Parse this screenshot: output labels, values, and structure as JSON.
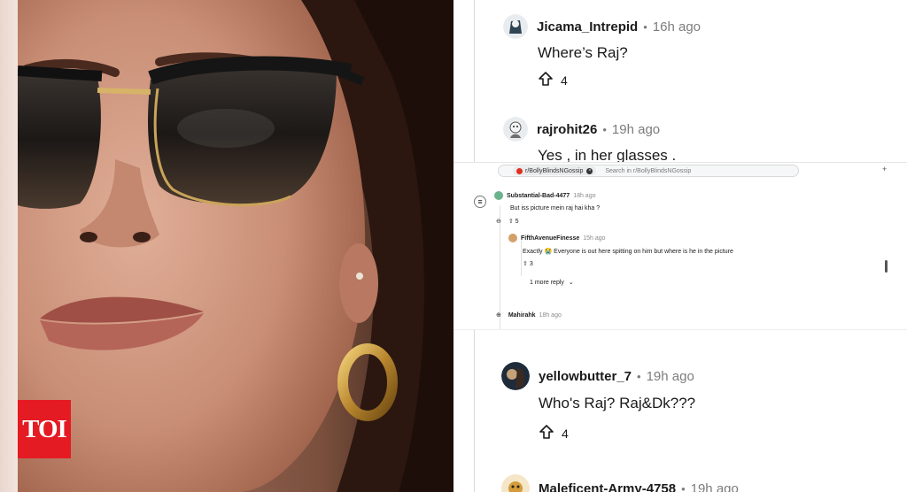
{
  "watermark": {
    "logo_text": "TOI"
  },
  "thread": {
    "comments": [
      {
        "username": "Jicama_Intrepid",
        "time": "16h ago",
        "text": "Where’s Raj?",
        "votes": "4"
      },
      {
        "username": "rajrohit26",
        "time": "19h ago",
        "text": "Yes , in her glasses ."
      },
      {
        "username": "yellowbutter_7",
        "time": "19h ago",
        "text": "Who's Raj? Raj&Dk???",
        "votes": "4"
      },
      {
        "username": "Maleficent-Army-4758",
        "time": "19h ago"
      }
    ],
    "separator": "•"
  },
  "inset": {
    "subreddit_chip": "r/BollyBlindsNGossip",
    "search_placeholder": "Search in r/BollyBlindsNGossip",
    "comments": [
      {
        "username": "Substantial-Bad-4477",
        "time": "18h ago",
        "text": "But iss picture mein raj hai kha ?",
        "votes": "5"
      },
      {
        "username": "FifthAvenueFinesse",
        "time": "15h ago",
        "text": "Exactly 😭  Everyone is out here spitting on him but where is he in the picture",
        "votes": "3"
      },
      {
        "username": "Mahirahk",
        "time": "18h ago"
      }
    ],
    "more_replies": "1 more reply",
    "plus": "+"
  },
  "colors": {
    "toi_red": "#e41b23",
    "meta_gray": "#7c7c7c",
    "thread_line": "#d7dadc"
  },
  "icons": [
    "upvote-icon",
    "chevron-down-icon",
    "expand-icon",
    "collapse-icon"
  ]
}
